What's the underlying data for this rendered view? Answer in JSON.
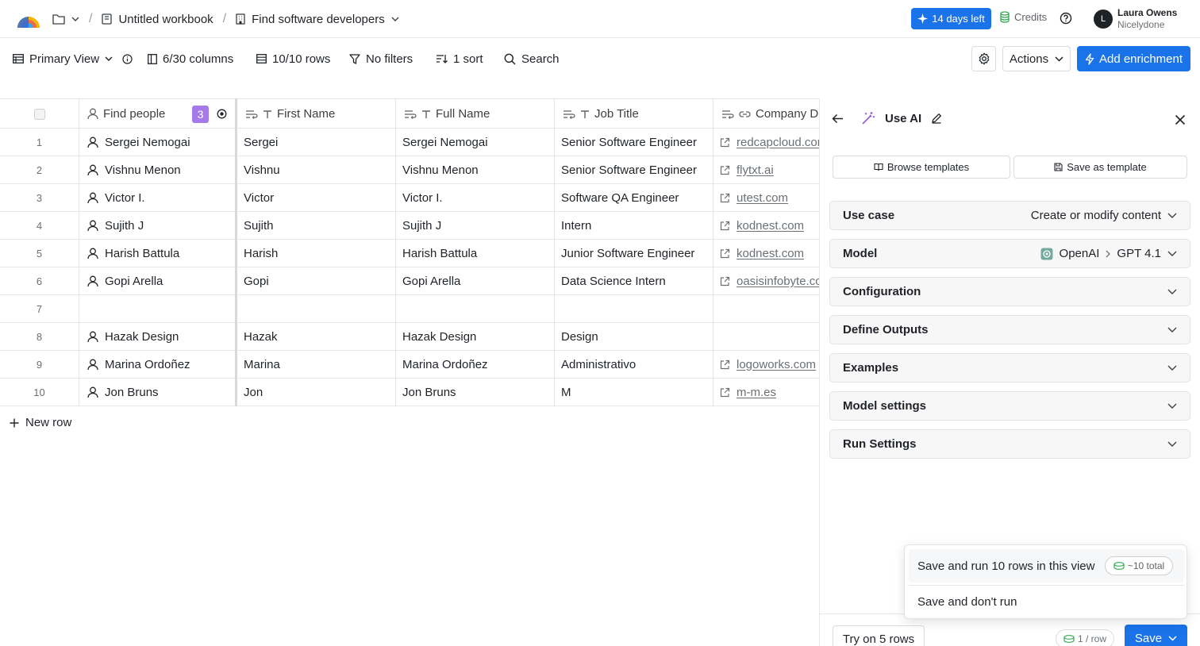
{
  "topbar": {
    "workbook": "Untitled workbook",
    "table": "Find software developers",
    "trial": "14 days left",
    "credits": "Credits",
    "user_initial": "L",
    "user_name": "Laura Owens",
    "user_org": "Nicelydone"
  },
  "toolbar": {
    "view": "Primary View",
    "columns": "6/30 columns",
    "rows": "10/10 rows",
    "filters": "No filters",
    "sort": "1 sort",
    "search": "Search",
    "actions": "Actions",
    "add_enrichment": "Add enrichment"
  },
  "table": {
    "headers": {
      "find_people": "Find people",
      "find_people_badge": "3",
      "first_name": "First Name",
      "full_name": "Full Name",
      "job_title": "Job Title",
      "company": "Company Do"
    },
    "rows": [
      {
        "n": "1",
        "person": "Sergei Nemogai",
        "first": "Sergei",
        "full": "Sergei Nemogai",
        "title": "Senior Software Engineer",
        "domain": "redcapcloud.com"
      },
      {
        "n": "2",
        "person": "Vishnu Menon",
        "first": "Vishnu",
        "full": "Vishnu Menon",
        "title": "Senior Software Engineer",
        "domain": "flytxt.ai"
      },
      {
        "n": "3",
        "person": "Victor I.",
        "first": "Victor",
        "full": "Victor I.",
        "title": "Software QA Engineer",
        "domain": "utest.com"
      },
      {
        "n": "4",
        "person": "Sujith J",
        "first": "Sujith",
        "full": "Sujith J",
        "title": "Intern",
        "domain": "kodnest.com"
      },
      {
        "n": "5",
        "person": "Harish Battula",
        "first": "Harish",
        "full": "Harish Battula",
        "title": "Junior Software Engineer",
        "domain": "kodnest.com"
      },
      {
        "n": "6",
        "person": "Gopi Arella",
        "first": "Gopi",
        "full": "Gopi Arella",
        "title": "Data Science Intern",
        "domain": "oasisinfobyte.com"
      },
      {
        "n": "7",
        "person": "",
        "first": "",
        "full": "",
        "title": "",
        "domain": ""
      },
      {
        "n": "8",
        "person": "Hazak Design",
        "first": "Hazak",
        "full": "Hazak Design",
        "title": "Design",
        "domain": ""
      },
      {
        "n": "9",
        "person": "Marina Ordoñez",
        "first": "Marina",
        "full": "Marina Ordoñez",
        "title": "Administrativo",
        "domain": "logoworks.com"
      },
      {
        "n": "10",
        "person": "Jon Bruns",
        "first": "Jon",
        "full": "Jon Bruns",
        "title": "M",
        "domain": "m-m.es"
      }
    ],
    "new_row": "New row"
  },
  "panel": {
    "title": "Use AI",
    "browse_templates": "Browse templates",
    "save_as_template": "Save as template",
    "sections": {
      "use_case": {
        "label": "Use case",
        "value": "Create or modify content"
      },
      "model": {
        "label": "Model",
        "provider": "OpenAI",
        "value": "GPT 4.1"
      },
      "configuration": {
        "label": "Configuration"
      },
      "define_outputs": {
        "label": "Define Outputs"
      },
      "examples": {
        "label": "Examples"
      },
      "model_settings": {
        "label": "Model settings"
      },
      "run_settings": {
        "label": "Run Settings"
      }
    },
    "menu": {
      "run_label": "Save and run 10 rows in this view",
      "run_cost": "~10 total",
      "dont_run": "Save and don't run"
    },
    "footer": {
      "try": "Try on 5 rows",
      "per_row": "1 / row",
      "save": "Save"
    }
  },
  "colors": {
    "accent": "#1a73e8",
    "badge": "#a57ae8"
  }
}
